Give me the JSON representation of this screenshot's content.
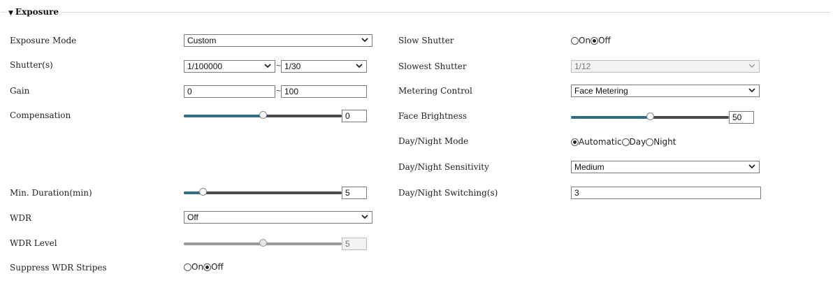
{
  "section": {
    "title": "Exposure"
  },
  "left": {
    "exposure_mode": {
      "label": "Exposure Mode",
      "value": "Custom"
    },
    "shutter": {
      "label": "Shutter(s)",
      "min": "1/100000",
      "max": "1/30",
      "separator": "~"
    },
    "gain": {
      "label": "Gain",
      "min": "0",
      "max": "100",
      "separator": "~"
    },
    "compensation": {
      "label": "Compensation",
      "value": "0",
      "level": 0.5
    },
    "min_duration": {
      "label": "Min. Duration(min)",
      "value": "5",
      "level": 0.1
    },
    "wdr": {
      "label": "WDR",
      "value": "Off"
    },
    "wdr_level": {
      "label": "WDR Level",
      "value": "5",
      "level": 0.5
    },
    "suppress_wdr_stripes": {
      "label": "Suppress WDR Stripes",
      "options": [
        "On",
        "Off"
      ],
      "selected": "Off"
    }
  },
  "right": {
    "slow_shutter": {
      "label": "Slow Shutter",
      "options": [
        "On",
        "Off"
      ],
      "selected": "Off"
    },
    "slowest_shutter": {
      "label": "Slowest Shutter",
      "value": "1/12"
    },
    "metering_control": {
      "label": "Metering Control",
      "value": "Face Metering"
    },
    "face_brightness": {
      "label": "Face Brightness",
      "value": "50",
      "level": 0.5
    },
    "day_night_mode": {
      "label": "Day/Night Mode",
      "options": [
        "Automatic",
        "Day",
        "Night"
      ],
      "selected": "Automatic"
    },
    "day_night_sensitivity": {
      "label": "Day/Night Sensitivity",
      "value": "Medium"
    },
    "day_night_switching": {
      "label": "Day/Night Switching(s)",
      "value": "3"
    }
  },
  "icons": {
    "collapse": "chevron-down-icon",
    "dropdown": "dropdown-arrow-icon"
  }
}
